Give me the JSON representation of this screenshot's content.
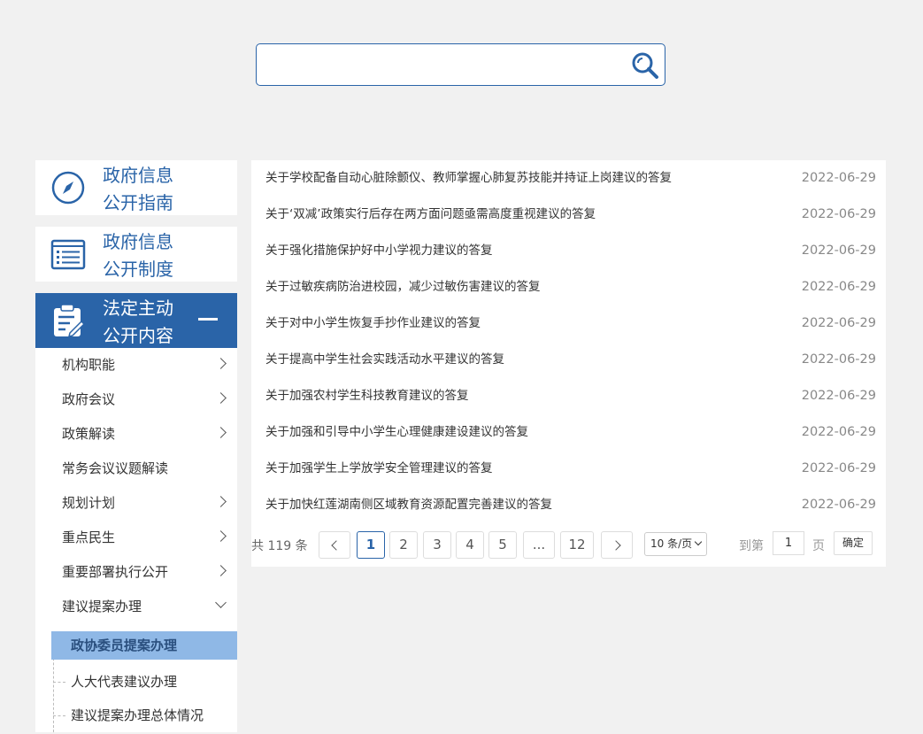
{
  "search": {
    "placeholder": "",
    "value": ""
  },
  "sidebar": {
    "cards": [
      {
        "line1": "政府信息",
        "line2": "公开指南",
        "icon": "compass-icon"
      },
      {
        "line1": "政府信息",
        "line2": "公开制度",
        "icon": "list-document-icon"
      },
      {
        "line1": "法定主动",
        "line2": "公开内容",
        "icon": "clipboard-edit-icon"
      }
    ],
    "items": [
      {
        "label": "机构职能"
      },
      {
        "label": "政府会议"
      },
      {
        "label": "政策解读"
      },
      {
        "label": "常务会议议题解读"
      },
      {
        "label": "规划计划"
      },
      {
        "label": "重点民生"
      },
      {
        "label": "重要部署执行公开"
      },
      {
        "label": "建议提案办理"
      }
    ],
    "leaves": [
      {
        "label": "政协委员提案办理"
      },
      {
        "label": "人大代表建议办理"
      },
      {
        "label": "建议提案办理总体情况"
      }
    ]
  },
  "list": [
    {
      "title": "关于学校配备自动心脏除颤仪、教师掌握心肺复苏技能并持证上岗建议的答复",
      "date": "2022-06-29"
    },
    {
      "title": "关于‘双减’政策实行后存在两方面问题亟需高度重视建议的答复",
      "date": "2022-06-29"
    },
    {
      "title": "关于强化措施保护好中小学视力建议的答复",
      "date": "2022-06-29"
    },
    {
      "title": "关于过敏疾病防治进校园，减少过敏伤害建议的答复",
      "date": "2022-06-29"
    },
    {
      "title": "关于对中小学生恢复手抄作业建议的答复",
      "date": "2022-06-29"
    },
    {
      "title": "关于提高中学生社会实践活动水平建议的答复",
      "date": "2022-06-29"
    },
    {
      "title": "关于加强农村学生科技教育建议的答复",
      "date": "2022-06-29"
    },
    {
      "title": "关于加强和引导中小学生心理健康建设建议的答复",
      "date": "2022-06-29"
    },
    {
      "title": "关于加强学生上学放学安全管理建议的答复",
      "date": "2022-06-29"
    },
    {
      "title": "关于加快红莲湖南侧区域教育资源配置完善建议的答复",
      "date": "2022-06-29"
    }
  ],
  "pager": {
    "total_text": "共 119 条",
    "pages": [
      "1",
      "2",
      "3",
      "4",
      "5",
      "...",
      "12"
    ],
    "current": "1",
    "page_size": "10 条/页",
    "goto_prefix": "到第",
    "goto_value": "1",
    "goto_suffix": "页",
    "confirm": "确定"
  },
  "colors": {
    "brand": "#2a64a8",
    "selected_leaf": "#8fb8e6"
  }
}
